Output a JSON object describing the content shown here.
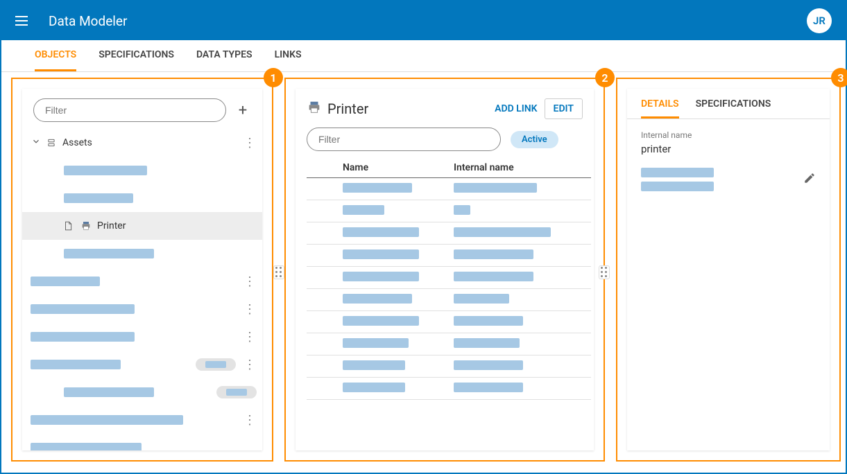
{
  "header": {
    "app_title": "Data Modeler",
    "user_initials": "JR"
  },
  "main_tabs": [
    {
      "label": "OBJECTS",
      "active": true
    },
    {
      "label": "SPECIFICATIONS",
      "active": false
    },
    {
      "label": "DATA TYPES",
      "active": false
    },
    {
      "label": "LINKS",
      "active": false
    }
  ],
  "panel1": {
    "badge": "1",
    "filter_placeholder": "Filter",
    "tree_root_label": "Assets",
    "selected_item_label": "Printer"
  },
  "panel2": {
    "badge": "2",
    "title": "Printer",
    "add_link_label": "ADD LINK",
    "edit_label": "EDIT",
    "filter_placeholder": "Filter",
    "active_chip": "Active",
    "columns": {
      "name": "Name",
      "internal_name": "Internal name"
    }
  },
  "panel3": {
    "badge": "3",
    "tabs": [
      {
        "label": "DETAILS",
        "active": true
      },
      {
        "label": "SPECIFICATIONS",
        "active": false
      }
    ],
    "internal_name_label": "Internal name",
    "internal_name_value": "printer"
  }
}
